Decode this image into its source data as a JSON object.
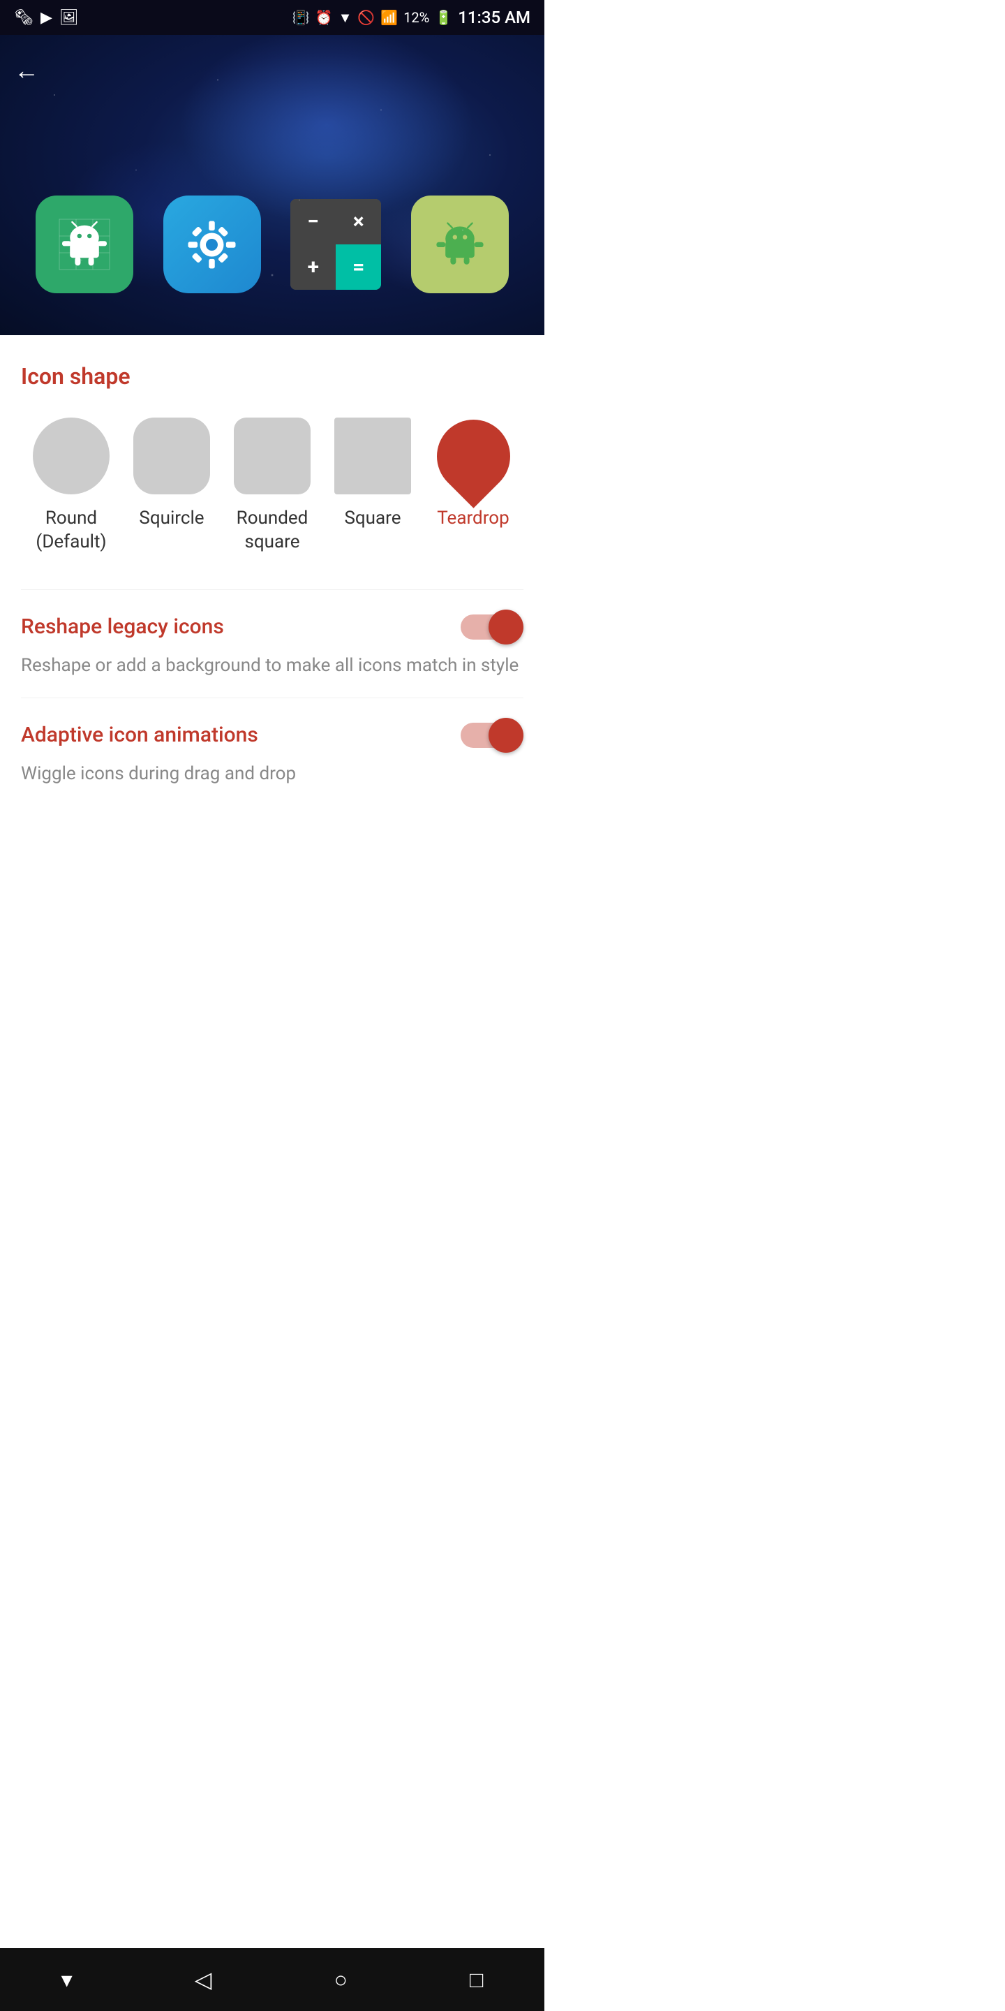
{
  "statusBar": {
    "leftIcons": [
      "NYT",
      "video",
      "image"
    ],
    "rightIcons": [
      "vibrate",
      "alarm",
      "wifi",
      "no-sim",
      "signal",
      "battery"
    ],
    "battery": "12%",
    "time": "11:35 AM"
  },
  "hero": {
    "backLabel": "←"
  },
  "iconShape": {
    "sectionTitle": "Icon shape",
    "shapes": [
      {
        "id": "round",
        "label": "Round\n(Default)",
        "selected": false
      },
      {
        "id": "squircle",
        "label": "Squircle",
        "selected": false
      },
      {
        "id": "rounded-square",
        "label": "Rounded\nsquare",
        "selected": false
      },
      {
        "id": "square",
        "label": "Square",
        "selected": false
      },
      {
        "id": "teardrop",
        "label": "Teardrop",
        "selected": true
      }
    ]
  },
  "settings": [
    {
      "id": "reshape-legacy",
      "title": "Reshape legacy icons",
      "description": "Reshape or add a background to make all icons match in style",
      "enabled": true
    },
    {
      "id": "adaptive-animations",
      "title": "Adaptive icon animations",
      "description": "Wiggle icons during drag and drop",
      "enabled": true
    }
  ],
  "bottomNav": {
    "items": [
      "dropdown",
      "back",
      "home",
      "recents"
    ]
  }
}
